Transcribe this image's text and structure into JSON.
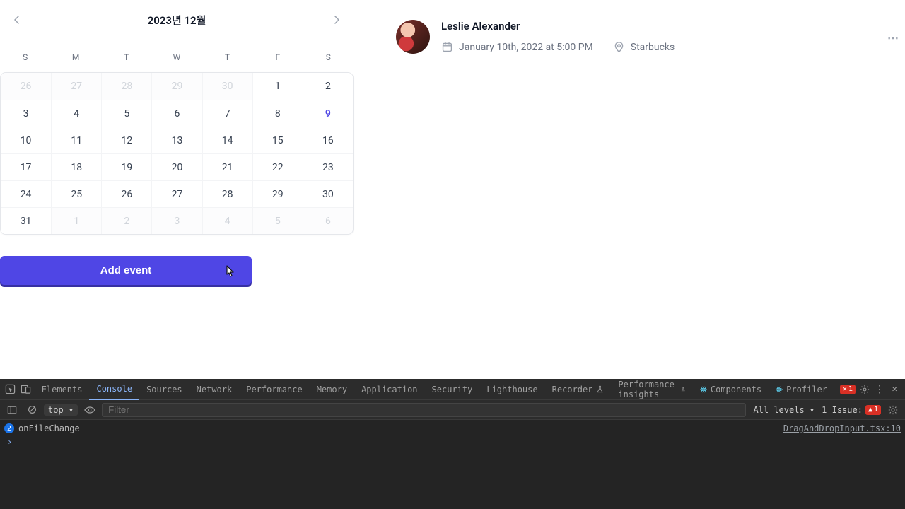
{
  "calendar": {
    "title": "2023년 12월",
    "weekdays": [
      "S",
      "M",
      "T",
      "W",
      "T",
      "F",
      "S"
    ],
    "today": 9,
    "days": [
      {
        "n": 26,
        "o": true
      },
      {
        "n": 27,
        "o": true
      },
      {
        "n": 28,
        "o": true
      },
      {
        "n": 29,
        "o": true
      },
      {
        "n": 30,
        "o": true
      },
      {
        "n": 1
      },
      {
        "n": 2
      },
      {
        "n": 3
      },
      {
        "n": 4
      },
      {
        "n": 5
      },
      {
        "n": 6
      },
      {
        "n": 7
      },
      {
        "n": 8
      },
      {
        "n": 9,
        "today": true
      },
      {
        "n": 10
      },
      {
        "n": 11
      },
      {
        "n": 12
      },
      {
        "n": 13
      },
      {
        "n": 14
      },
      {
        "n": 15
      },
      {
        "n": 16
      },
      {
        "n": 17
      },
      {
        "n": 18
      },
      {
        "n": 19
      },
      {
        "n": 20
      },
      {
        "n": 21
      },
      {
        "n": 22
      },
      {
        "n": 23
      },
      {
        "n": 24
      },
      {
        "n": 25
      },
      {
        "n": 26
      },
      {
        "n": 27
      },
      {
        "n": 28
      },
      {
        "n": 29
      },
      {
        "n": 30
      },
      {
        "n": 31
      },
      {
        "n": 1,
        "o": true
      },
      {
        "n": 2,
        "o": true
      },
      {
        "n": 3,
        "o": true
      },
      {
        "n": 4,
        "o": true
      },
      {
        "n": 5,
        "o": true
      },
      {
        "n": 6,
        "o": true
      }
    ],
    "add_button": "Add event"
  },
  "event": {
    "name": "Leslie Alexander",
    "datetime": "January 10th, 2022 at 5:00 PM",
    "location": "Starbucks"
  },
  "devtools": {
    "tabs": [
      "Elements",
      "Console",
      "Sources",
      "Network",
      "Performance",
      "Memory",
      "Application",
      "Security",
      "Lighthouse",
      "Recorder",
      "Performance insights",
      "Components",
      "Profiler"
    ],
    "active_tab": "Console",
    "error_count": "1",
    "toolbar": {
      "scope": "top",
      "filter_placeholder": "Filter",
      "levels": "All levels",
      "issues_label": "1 Issue:",
      "issues_count": "1"
    },
    "log": {
      "message": "onFileChange",
      "source": "DragAndDropInput.tsx:10"
    }
  }
}
